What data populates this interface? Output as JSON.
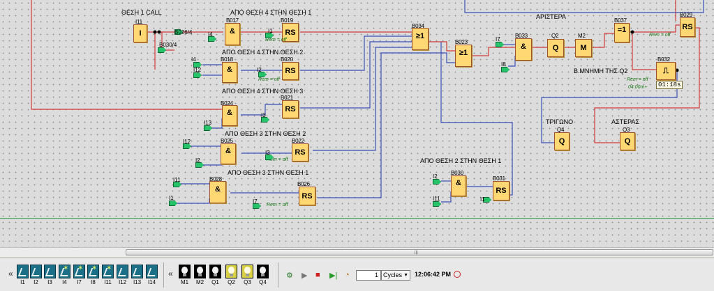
{
  "diagram": {
    "titles": {
      "pos1_call": "ΘΕΣΗ 1 CALL",
      "pos4_to_1": "ΑΠΟ ΘΕΣΗ 4 ΣΤΗΝ ΘΕΣΗ 1",
      "pos4_to_2": "ΑΠΟ ΘΕΣΗ 4 ΣΤΗΝ ΘΕΣΗ 2",
      "pos4_to_3": "ΑΠΟ ΘΕΣΗ 4 ΣΤΗΝ ΘΕΣΗ 3",
      "pos3_to_2": "ΑΠΟ ΘΕΣΗ 3 ΣΤΗΝ ΘΕΣΗ 2",
      "pos3_to_1": "ΑΠΟ ΘΕΣΗ 3 ΣΤΗΝ ΘΕΣΗ 1",
      "pos2_to_1": "ΑΠΟ ΘΕΣΗ 2 ΣΤΗΝ ΘΕΣΗ 1",
      "left": "ΑΡΙΣΤΕΡΑ",
      "memory_q2": "Β.ΜΝΗΜΗ ΤΗΣ Q2",
      "triangle": "ΤΡΙΓΩΝΟ",
      "star": "ΑΣΤΕΡΑΣ"
    },
    "blocks": {
      "i11_block": {
        "label": "I11",
        "sym": "I"
      },
      "b017": {
        "label": "B017",
        "sym": "&"
      },
      "b019": {
        "label": "B019",
        "sym": "RS"
      },
      "b018": {
        "label": "B018",
        "sym": "&"
      },
      "b020": {
        "label": "B020",
        "sym": "RS"
      },
      "b024": {
        "label": "B024",
        "sym": "&"
      },
      "b021": {
        "label": "B021",
        "sym": "RS"
      },
      "b025": {
        "label": "B025",
        "sym": "&"
      },
      "b022": {
        "label": "B022",
        "sym": "RS"
      },
      "b028": {
        "label": "B028",
        "sym": "&"
      },
      "b026": {
        "label": "B026",
        "sym": "RS"
      },
      "b034": {
        "label": "B034",
        "sym": "≥1"
      },
      "b023": {
        "label": "B023",
        "sym": "≥1"
      },
      "b033": {
        "label": "B033",
        "sym": "&"
      },
      "q2": {
        "label": "Q2",
        "sym": "Q"
      },
      "m2": {
        "label": "M2",
        "sym": "M"
      },
      "b037": {
        "label": "B037",
        "sym": "=1"
      },
      "b029": {
        "label": "B029",
        "sym": "RS"
      },
      "b032": {
        "label": "B032",
        "sym": "⎍"
      },
      "q4": {
        "label": "Q4",
        "sym": "Q"
      },
      "q3": {
        "label": "Q3",
        "sym": "Q"
      },
      "b030": {
        "label": "B030",
        "sym": "&"
      },
      "b031": {
        "label": "B031",
        "sym": "RS"
      }
    },
    "connectors": {
      "b026_4": "B026/4",
      "b030_4": "B030/4"
    },
    "pins": [
      "I4",
      "I1",
      "I4",
      "I12",
      "I2",
      "I13",
      "I3",
      "I12",
      "I2",
      "I3",
      "I11",
      "I1",
      "I7",
      "I8",
      "I2",
      "I11",
      "I1"
    ],
    "remanence": "Rem = off",
    "timer_small": "04:00m+",
    "timer_display": "01:18s"
  },
  "toolbar": {
    "inputs": [
      {
        "label": "I1",
        "on": false
      },
      {
        "label": "I2",
        "on": false
      },
      {
        "label": "I3",
        "on": false
      },
      {
        "label": "I4",
        "on": true
      },
      {
        "label": "I7",
        "on": true
      },
      {
        "label": "I8",
        "on": true
      },
      {
        "label": "I11",
        "on": true
      },
      {
        "label": "I12",
        "on": false
      },
      {
        "label": "I13",
        "on": false
      },
      {
        "label": "I14",
        "on": false
      }
    ],
    "outputs": [
      {
        "label": "M1",
        "on": false
      },
      {
        "label": "M2",
        "on": false
      },
      {
        "label": "Q1",
        "on": false
      },
      {
        "label": "Q2",
        "on": true
      },
      {
        "label": "Q3",
        "on": true
      },
      {
        "label": "Q4",
        "on": false
      }
    ],
    "cycles_value": "1",
    "cycles_unit": "Cycles",
    "clock": "12:06:42 PM",
    "colors": {
      "accent": "#ffd773",
      "wire_red": "#d23a3a",
      "wire_blue": "#3a4fb8",
      "flag": "#27c36a"
    }
  }
}
